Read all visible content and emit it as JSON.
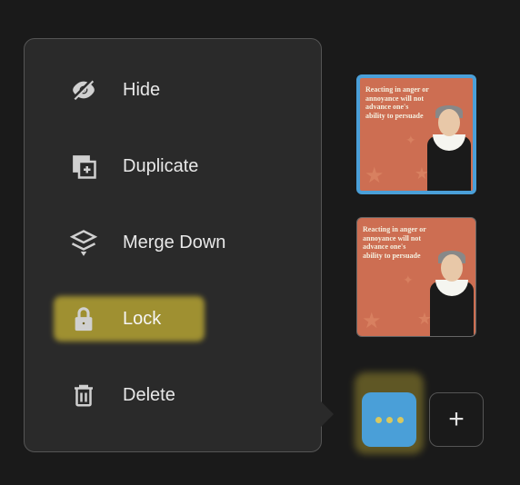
{
  "menu": {
    "items": [
      {
        "icon": "hide",
        "label": "Hide"
      },
      {
        "icon": "duplicate",
        "label": "Duplicate"
      },
      {
        "icon": "merge-down",
        "label": "Merge Down"
      },
      {
        "icon": "lock",
        "label": "Lock",
        "highlighted": true
      },
      {
        "icon": "delete",
        "label": "Delete"
      }
    ]
  },
  "layers": {
    "thumb_text": "Reacting in anger or annoyance will not advance one's ability to persuade",
    "items": [
      {
        "selected": true
      },
      {
        "selected": false
      }
    ]
  },
  "buttons": {
    "more": "more",
    "add": "add"
  }
}
